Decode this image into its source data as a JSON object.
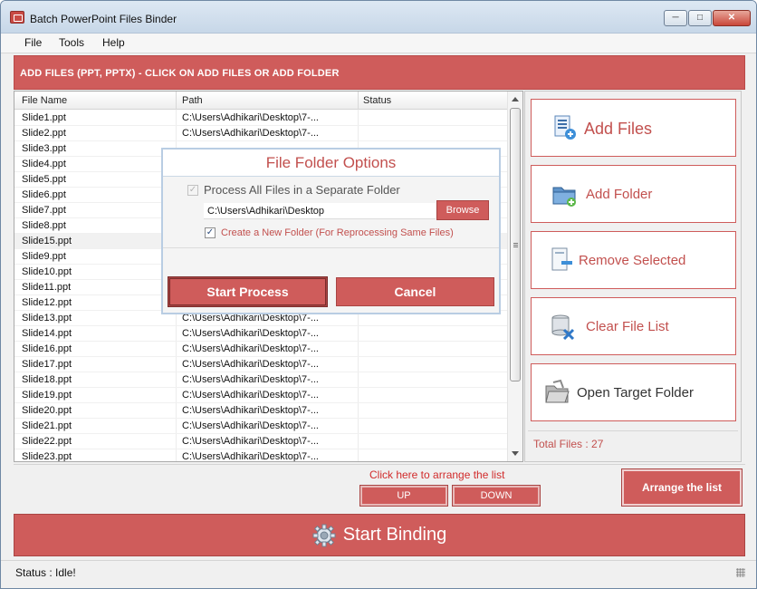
{
  "window": {
    "title": "Batch PowerPoint Files Binder"
  },
  "menu": [
    "File",
    "Tools",
    "Help"
  ],
  "header": {
    "text": "ADD FILES (PPT, PPTX) - CLICK ON ADD FILES OR ADD FOLDER"
  },
  "table": {
    "columns": [
      "File Name",
      "Path",
      "Status"
    ],
    "rows": [
      {
        "name": "Slide1.ppt",
        "path": "C:\\Users\\Adhikari\\Desktop\\7-..."
      },
      {
        "name": "Slide2.ppt",
        "path": "C:\\Users\\Adhikari\\Desktop\\7-..."
      },
      {
        "name": "Slide3.ppt",
        "path": ""
      },
      {
        "name": "Slide4.ppt",
        "path": ""
      },
      {
        "name": "Slide5.ppt",
        "path": ""
      },
      {
        "name": "Slide6.ppt",
        "path": ""
      },
      {
        "name": "Slide7.ppt",
        "path": ""
      },
      {
        "name": "Slide8.ppt",
        "path": ""
      },
      {
        "name": "Slide15.ppt",
        "path": "",
        "selected": true
      },
      {
        "name": "Slide9.ppt",
        "path": ""
      },
      {
        "name": "Slide10.ppt",
        "path": ""
      },
      {
        "name": "Slide11.ppt",
        "path": ""
      },
      {
        "name": "Slide12.ppt",
        "path": ""
      },
      {
        "name": "Slide13.ppt",
        "path": "C:\\Users\\Adhikari\\Desktop\\7-..."
      },
      {
        "name": "Slide14.ppt",
        "path": "C:\\Users\\Adhikari\\Desktop\\7-..."
      },
      {
        "name": "Slide16.ppt",
        "path": "C:\\Users\\Adhikari\\Desktop\\7-..."
      },
      {
        "name": "Slide17.ppt",
        "path": "C:\\Users\\Adhikari\\Desktop\\7-..."
      },
      {
        "name": "Slide18.ppt",
        "path": "C:\\Users\\Adhikari\\Desktop\\7-..."
      },
      {
        "name": "Slide19.ppt",
        "path": "C:\\Users\\Adhikari\\Desktop\\7-..."
      },
      {
        "name": "Slide20.ppt",
        "path": "C:\\Users\\Adhikari\\Desktop\\7-..."
      },
      {
        "name": "Slide21.ppt",
        "path": "C:\\Users\\Adhikari\\Desktop\\7-..."
      },
      {
        "name": "Slide22.ppt",
        "path": "C:\\Users\\Adhikari\\Desktop\\7-..."
      },
      {
        "name": "Slide23.ppt",
        "path": "C:\\Users\\Adhikari\\Desktop\\7-..."
      }
    ]
  },
  "side": {
    "add_files": "Add Files",
    "add_folder": "Add Folder",
    "remove_selected": "Remove Selected",
    "clear_list": "Clear File List",
    "open_target": "Open Target Folder",
    "total_files": "Total Files : 27"
  },
  "dialog": {
    "title": "File Folder Options",
    "opt_separate": "Process All Files in a Separate Folder",
    "path_value": "C:\\Users\\Adhikari\\Desktop",
    "browse": "Browse",
    "opt_new_folder": "Create a New Folder (For Reprocessing Same Files)",
    "start": "Start Process",
    "cancel": "Cancel"
  },
  "arrange": {
    "hint": "Click here to arrange the list",
    "up": "UP",
    "down": "DOWN",
    "arrange_button": "Arrange the list"
  },
  "bind": {
    "label": "Start Binding"
  },
  "status": {
    "text": "Status  :  Idle!"
  },
  "colors": {
    "accent": "#cf5c5b",
    "accent_text": "#c2504e",
    "hint": "#d12b2b"
  }
}
